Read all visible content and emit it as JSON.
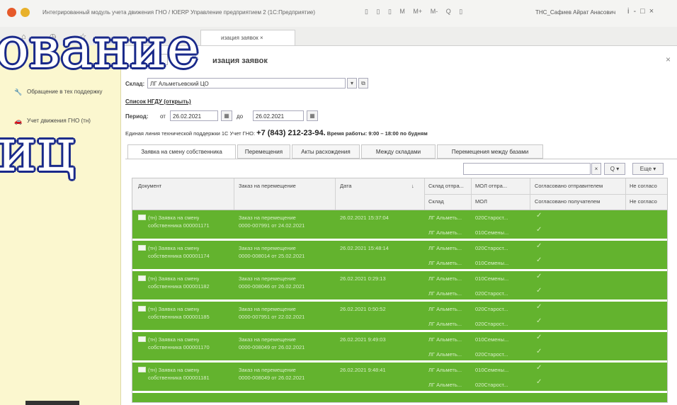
{
  "app": {
    "title": "Интегрированный модуль учета движения ГНО / ЮERP Управление предприятием 2 (1С:Предприятие)",
    "user": "ТНС_Сафиев Айрат Анасович",
    "tools": [
      "▯",
      "▯",
      "▯",
      "M",
      "M+",
      "M-",
      "Q",
      "▯"
    ],
    "window_controls": [
      "i",
      "-",
      "□",
      "×"
    ]
  },
  "tabs": {
    "active_label": "изация заявок ×"
  },
  "sidebar": {
    "items": [
      {
        "icon": "wrench-icon",
        "label": "Обращение в тех поддержку"
      },
      {
        "icon": "car-icon",
        "label": "Учет движения ГНО (тн)"
      }
    ]
  },
  "overlay": {
    "line1": "ование",
    "line2": "иц"
  },
  "main": {
    "title": "изация заявок",
    "warehouse_label": "Склад:",
    "warehouse_value": "ЛГ Альметьевский ЦО",
    "list_link": "Список НГДУ (открыть)",
    "period_label": "Период:",
    "from_label": "от",
    "from_value": "26.02.2021",
    "to_label": "до",
    "to_value": "26.02.2021",
    "support_prefix": "Единая линия технической поддержки 1С Учет ГНО:",
    "support_phone": "+7 (843) 212-23-94.",
    "support_hours": "Время работы: 9:00 – 18:00 по будням"
  },
  "doc_tabs": [
    "Заявка на смену собственника",
    "Перемещения",
    "Акты расхождения",
    "Между складами",
    "Перемещения между базами"
  ],
  "toolbar": {
    "search_placeholder": "",
    "find_label": "Q",
    "more_label": "Еще"
  },
  "table": {
    "headers": {
      "document": "Документ",
      "order": "Заказ на перемещение",
      "date": "Дата",
      "sort_icon": "↓",
      "sender_wh": "Склад отпра...",
      "sender_mol": "МОЛ отпра...",
      "approved_sender": "Согласовано отправителем",
      "not_approved": "Не согласо",
      "wh": "Склад",
      "mol": "МОЛ",
      "approved_receiver": "Согласовано получателем",
      "not_approved2": "Не согласо"
    },
    "rows": [
      {
        "doc1": "(тн) Заявка на смену",
        "doc2": "собственника 000001171",
        "ord1": "Заказ на перемещение",
        "ord2": "0000-007991 от 24.02.2021",
        "date": "26.02.2021 15:37:04",
        "wh1": "ЛГ Альметь...",
        "wh2": "ЛГ Альметь...",
        "mol1": "020Старост...",
        "mol2": "010Семены..."
      },
      {
        "doc1": "(тн) Заявка на смену",
        "doc2": "собственника 000001174",
        "ord1": "Заказ на перемещение",
        "ord2": "0000-008014 от 25.02.2021",
        "date": "26.02.2021 15:48:14",
        "wh1": "ЛГ Альметь...",
        "wh2": "ЛГ Альметь...",
        "mol1": "020Старост...",
        "mol2": "010Семены..."
      },
      {
        "doc1": "(тн) Заявка на смену",
        "doc2": "собственника 000001182",
        "ord1": "Заказ на перемещение",
        "ord2": "0000-008046 от 26.02.2021",
        "date": "26.02.2021 0:29:13",
        "wh1": "ЛГ Альметь...",
        "wh2": "ЛГ Альметь...",
        "mol1": "010Семены...",
        "mol2": "020Старост..."
      },
      {
        "doc1": "(тн) Заявка на смену",
        "doc2": "собственника 000001185",
        "ord1": "Заказ на перемещение",
        "ord2": "0000-007951 от 22.02.2021",
        "date": "26.02.2021 0:50:52",
        "wh1": "ЛГ Альметь...",
        "wh2": "ЛГ Альметь...",
        "mol1": "020Старост...",
        "mol2": "020Старост..."
      },
      {
        "doc1": "(тн) Заявка на смену",
        "doc2": "собственника 000001170",
        "ord1": "Заказ на перемещение",
        "ord2": "0000-008049 от 26.02.2021",
        "date": "26.02.2021 9:49:03",
        "wh1": "ЛГ Альметь...",
        "wh2": "ЛГ Альметь...",
        "mol1": "010Семены...",
        "mol2": "020Старост..."
      },
      {
        "doc1": "(тн) Заявка на смену",
        "doc2": "собственника 000001181",
        "ord1": "Заказ на перемещение",
        "ord2": "0000-008049 от 26.02.2021",
        "date": "26.02.2021 9:48:41",
        "wh1": "ЛГ Альметь...",
        "wh2": "ЛГ Альметь...",
        "mol1": "010Семены...",
        "mol2": "020Старост..."
      }
    ]
  },
  "colors": {
    "row_green": "#63b32e",
    "sidebar_bg": "#fbf7cf",
    "overlay_stroke": "#1a2a8a"
  }
}
